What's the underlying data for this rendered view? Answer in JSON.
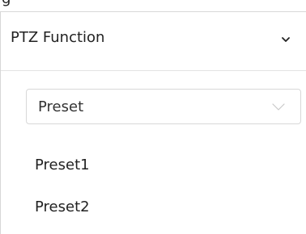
{
  "top_fragment": "g",
  "panel": {
    "title": "PTZ Function",
    "collapse_icon": "chevron-down-icon"
  },
  "select": {
    "value": "Preset",
    "dropdown_icon": "chevron-down-icon"
  },
  "presets": [
    "Preset1",
    "Preset2"
  ],
  "colors": {
    "text": "#222222",
    "border": "#d7d7d7",
    "select_chevron": "#c8c8c8"
  }
}
